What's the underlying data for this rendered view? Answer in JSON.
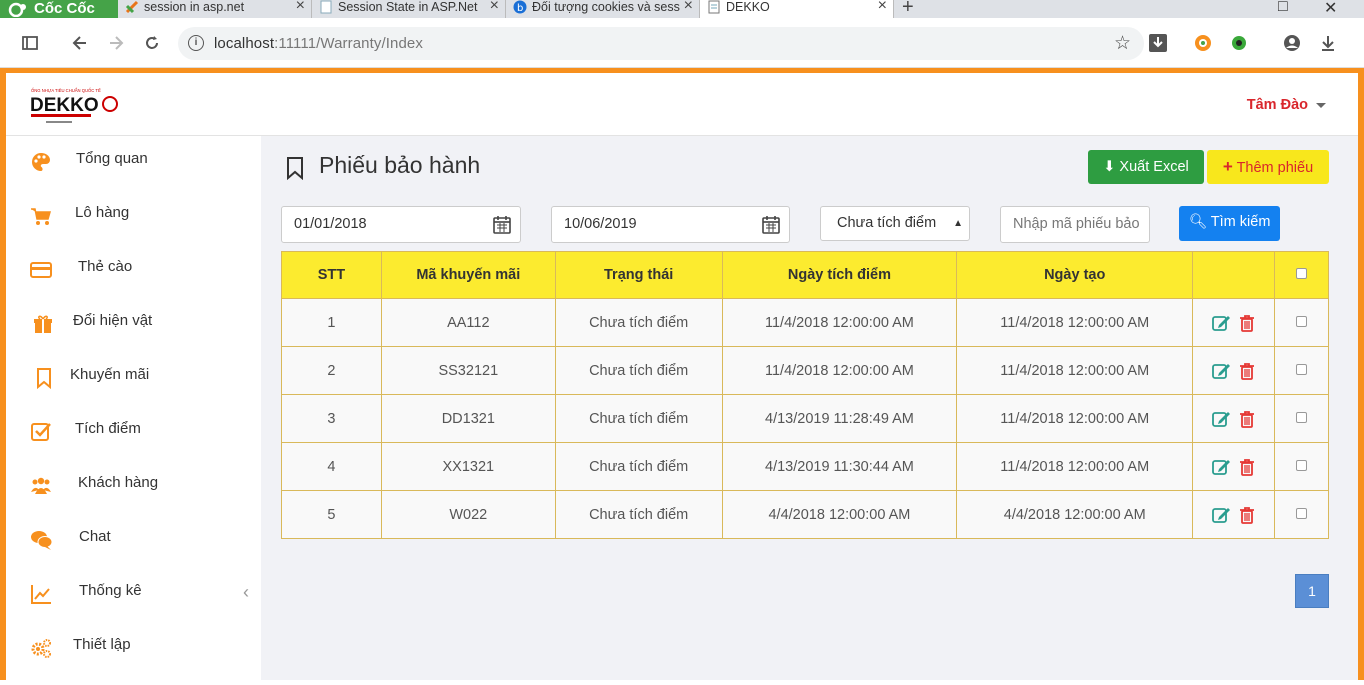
{
  "browser": {
    "brand": "Cốc Cốc",
    "tabs": [
      {
        "title": "session in asp.net",
        "icon": "coccoc-leaf-icon"
      },
      {
        "title": "Session State in ASP.Net",
        "icon": "page-icon"
      },
      {
        "title": "Đối tượng cookies và sess",
        "icon": "bing-icon"
      },
      {
        "title": "DEKKO",
        "icon": "doc-icon",
        "active": true
      }
    ],
    "url_host": "localhost",
    "url_path": ":11111/Warranty/Index"
  },
  "header": {
    "logo_text": "DEKKO",
    "user_name": "Tâm Đào"
  },
  "sidebar": {
    "items": [
      {
        "label": "Tổng quan",
        "icon": "palette-icon"
      },
      {
        "label": "Lô hàng",
        "icon": "cart-icon"
      },
      {
        "label": "Thẻ cào",
        "icon": "credit-card-icon"
      },
      {
        "label": "Đổi hiện vật",
        "icon": "gift-icon"
      },
      {
        "label": "Khuyến mãi",
        "icon": "bookmark-icon"
      },
      {
        "label": "Tích điểm",
        "icon": "check-square-icon"
      },
      {
        "label": "Khách hàng",
        "icon": "users-icon"
      },
      {
        "label": "Chat",
        "icon": "chat-icon"
      },
      {
        "label": "Thống kê",
        "icon": "line-chart-icon",
        "has_arrow": true
      },
      {
        "label": "Thiết lập",
        "icon": "gears-icon"
      }
    ]
  },
  "main": {
    "title": "Phiếu bảo hành",
    "export_label": "Xuất Excel",
    "add_label": "Thêm phiếu",
    "filters": {
      "from_date": "01/01/2018",
      "to_date": "10/06/2019",
      "status": "Chưa tích điểm",
      "code_placeholder": "Nhập mã phiếu bảo",
      "search_label": "Tìm kiếm"
    },
    "table": {
      "columns": [
        "STT",
        "Mã khuyến mãi",
        "Trạng thái",
        "Ngày tích điểm",
        "Ngày tạo"
      ],
      "rows": [
        [
          "1",
          "AA112",
          "Chưa tích điểm",
          "11/4/2018 12:00:00 AM",
          "11/4/2018 12:00:00 AM"
        ],
        [
          "2",
          "SS32121",
          "Chưa tích điểm",
          "11/4/2018 12:00:00 AM",
          "11/4/2018 12:00:00 AM"
        ],
        [
          "3",
          "DD1321",
          "Chưa tích điểm",
          "4/13/2019 11:28:49 AM",
          "11/4/2018 12:00:00 AM"
        ],
        [
          "4",
          "XX1321",
          "Chưa tích điểm",
          "4/13/2019 11:30:44 AM",
          "11/4/2018 12:00:00 AM"
        ],
        [
          "5",
          "W022",
          "Chưa tích điểm",
          "4/4/2018 12:00:00 AM",
          "4/4/2018 12:00:00 AM"
        ]
      ]
    },
    "pagination": {
      "current": "1"
    }
  },
  "colors": {
    "accent": "#f7901e",
    "header_yellow": "#fceb2f",
    "excel_green": "#2e9d41",
    "search_blue": "#1481f0",
    "user_red": "#d9262c"
  }
}
